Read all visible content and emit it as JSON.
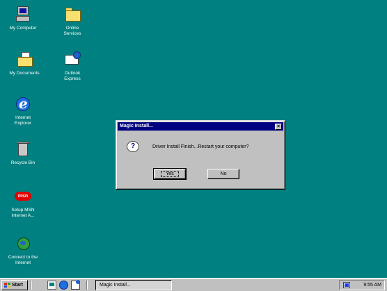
{
  "desktop": {
    "background": "#008080",
    "icons": [
      {
        "label": "My Computer",
        "icon": "computer-icon"
      },
      {
        "label": "Online Services",
        "icon": "folder-icon"
      },
      {
        "label": "My Documents",
        "icon": "documents-icon"
      },
      {
        "label": "Outlook Express",
        "icon": "outlook-express-icon"
      },
      {
        "label": "Internet Explorer",
        "icon": "internet-explorer-icon"
      },
      {
        "label": "Recycle Bin",
        "icon": "recycle-bin-icon"
      },
      {
        "label": "Setup MSN Internet A...",
        "icon": "msn-icon",
        "badge": "msn"
      },
      {
        "label": "Connect to the Internet",
        "icon": "globe-icon"
      }
    ]
  },
  "dialog": {
    "title": "Magic Install...",
    "close_glyph": "×",
    "icon": "question-icon",
    "icon_glyph": "?",
    "message": "Driver Install Finish...Restart your computer?",
    "buttons": {
      "yes": "Yes",
      "no": "No"
    }
  },
  "taskbar": {
    "start_label": "Start",
    "quick_launch": [
      "show-desktop-icon",
      "internet-explorer-icon",
      "outlook-express-icon"
    ],
    "task_button": "Magic Install...",
    "tray_icon": "display-settings-icon",
    "clock": "9:55 AM"
  }
}
